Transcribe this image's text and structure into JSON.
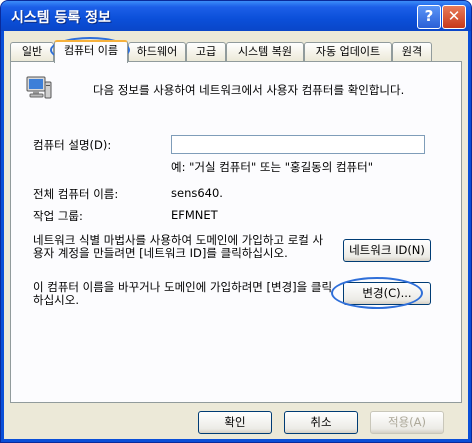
{
  "window": {
    "title": "시스템 등록 정보",
    "help_label": "?",
    "close_label": "✕",
    "colors": {
      "titlebar": "#0b4fd9",
      "client": "#ece9d8",
      "highlight": "#2f6fd9"
    }
  },
  "tabs": [
    "일반",
    "컴퓨터 이름",
    "하드웨어",
    "고급",
    "시스템 복원",
    "자동 업데이트",
    "원격"
  ],
  "active_tab": "컴퓨터 이름",
  "panel": {
    "intro_icon": "computer-icon",
    "intro": "다음 정보를 사용하여 네트워크에서 사용자 컴퓨터를 확인합니다.",
    "description_label": "컴퓨터 설명(D):",
    "description_value": "",
    "example": "예: \"거실 컴퓨터\" 또는 \"홍길동의 컴퓨터\"",
    "full_name_label": "전체 컴퓨터 이름:",
    "full_name_value": "sens640.",
    "workgroup_label": "작업 그룹:",
    "workgroup_value": "EFMNET",
    "network_id_text": "네트워크 식별 마법사를 사용하여 도메인에 가입하고 로컬 사용자 계정을 만들려면 [네트워크 ID]를 클릭하십시오.",
    "network_id_button": "네트워크 ID(N)",
    "rename_text": "이 컴퓨터 이름을 바꾸거나 도메인에 가입하려면 [변경]을 클릭하십시오.",
    "change_button": "변경(C)..."
  },
  "footer": {
    "ok": "확인",
    "cancel": "취소",
    "apply": "적용(A)"
  }
}
